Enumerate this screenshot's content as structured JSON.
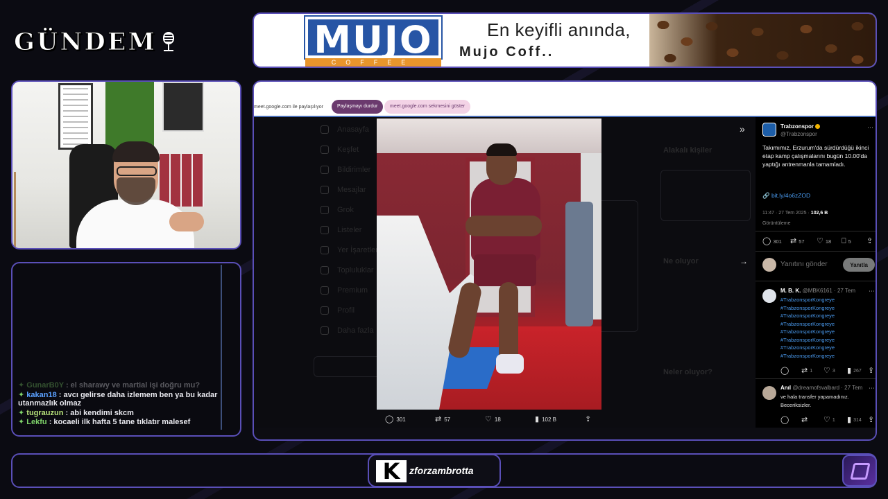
{
  "logo": {
    "text": "GÜNDEM",
    "icon": "microphone-icon"
  },
  "ad": {
    "brand": "MUJO",
    "brand_sub": "COFFEE",
    "slogan": "En keyifli anında,",
    "tagline": "Mujo Coff.."
  },
  "chat": {
    "messages": [
      {
        "user": "GunarB0Y",
        "text": ": el sharawy ve martial işi doğru mu?",
        "color": "#7fd36a",
        "faded": true
      },
      {
        "user": "kakan18",
        "text": ": avcı gelirse daha izlemem ben ya bu kadar utanmazlık olmaz",
        "color": "#5aa0ff",
        "faded": false
      },
      {
        "user": "tugrauzun",
        "text": ": abi kendimi skcm",
        "color": "#b7e27a",
        "faded": false
      },
      {
        "user": "Lekfu",
        "text": ": kocaeli ilk hafta 5 tane tıklatır malesef",
        "color": "#7fd36a",
        "faded": false
      }
    ]
  },
  "share_bar": {
    "text": "meet.google.com ile paylaşılıyor",
    "stop_button": "Paylaşmayı durdur",
    "show_tab_button": "meet.google.com sekmesini göster"
  },
  "media_actions": {
    "replies": "301",
    "retweets": "57",
    "likes": "18",
    "views": "102 B"
  },
  "tweet": {
    "name": "Trabzonspor",
    "handle": "@Trabzonspor",
    "text": "Takımımız, Erzurum'da sürdürdüğü ikinci etap kamp çalışmalarını bugün 10.00'da yaptığı antrenmanla tamamladı.",
    "link": "bit.ly/4o6zZOD",
    "time": "11:47 · 27 Tem 2025 ·",
    "views": "102,6 B",
    "views_label": "Görüntüleme",
    "replies": "301",
    "retweets": "57",
    "likes": "18",
    "bookmarks": "5"
  },
  "reply_box": {
    "placeholder": "Yanıtını gönder",
    "button": "Yanıtla"
  },
  "replies": [
    {
      "name": "M. B. K.",
      "meta": "@MBK6161 · 27 Tem",
      "tags": [
        "#TrabzonsporKongreye",
        "#TrabzonsporKongreye",
        "#TrabzonsporKongreye",
        "#TrabzonsporKongreye",
        "#TrabzonsporKongreye",
        "#TrabzonsporKongreye",
        "#TrabzonsporKongreye",
        "#TrabzonsporKongreye"
      ],
      "retweets": "1",
      "likes": "3",
      "views": "267"
    },
    {
      "name": "Anıl",
      "meta": "@dreamofsvalbard · 27 Tem",
      "text": "ve hala transfer yapamadınız. Beceriksizler.",
      "likes": "1",
      "views": "314"
    }
  ],
  "ghost_nav": [
    "Anasayfa",
    "Keşfet",
    "Bildirimler",
    "Mesajlar",
    "Grok",
    "Listeler",
    "Yer İşaretleri",
    "Topluluklar",
    "Premium",
    "Profil",
    "Daha fazla"
  ],
  "ghost_right": [
    "Alakalı kişiler",
    "Ne oluyor",
    "Neler oluyor?"
  ],
  "brand": {
    "k": "K",
    "name": "zforzambrotta"
  },
  "colors": {
    "frame": "#5a4fb8",
    "accent_link": "#4a9bf0",
    "share_stop": "#6b3a6e"
  }
}
